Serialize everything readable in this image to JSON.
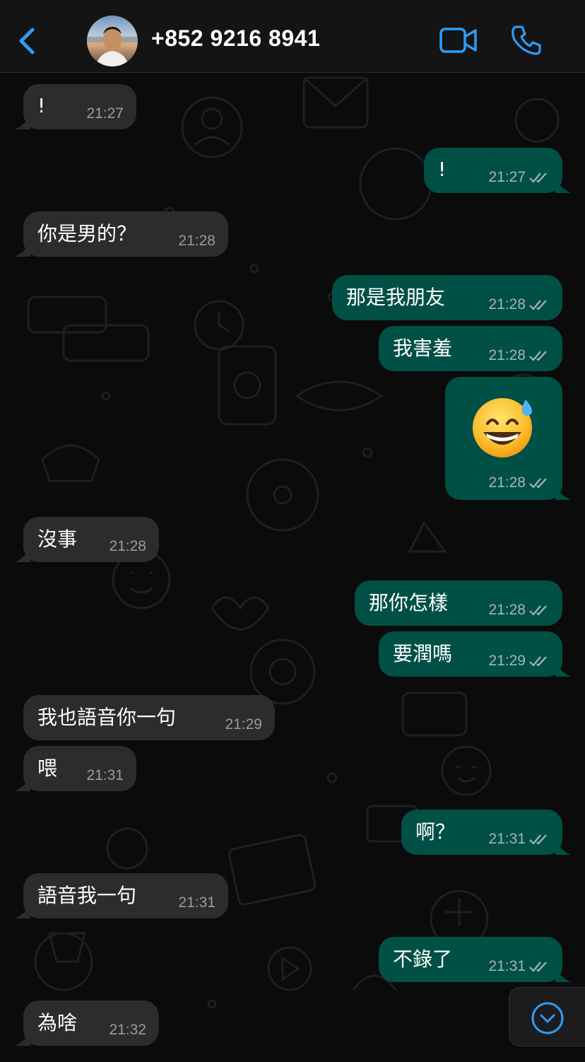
{
  "header": {
    "contact_name": "+852 9216 8941",
    "back_icon": "chevron-left-icon",
    "video_icon": "video-camera-icon",
    "call_icon": "phone-icon",
    "accent": "#2f9cf5"
  },
  "messages": [
    {
      "dir": "in",
      "text": "!",
      "time": "21:27"
    },
    {
      "dir": "out",
      "text": "!",
      "time": "21:27",
      "status": "read"
    },
    {
      "dir": "in",
      "text": "你是男的？",
      "time": "21:28"
    },
    {
      "dir": "out",
      "text": "那是我朋友",
      "time": "21:28",
      "status": "read"
    },
    {
      "dir": "out",
      "text": "我害羞",
      "time": "21:28",
      "status": "read"
    },
    {
      "dir": "out",
      "text": "😅",
      "time": "21:28",
      "status": "read",
      "kind": "emoji"
    },
    {
      "dir": "in",
      "text": "沒事",
      "time": "21:28"
    },
    {
      "dir": "out",
      "text": "那你怎樣",
      "time": "21:28",
      "status": "read"
    },
    {
      "dir": "out",
      "text": "要潤嗎",
      "time": "21:29",
      "status": "read"
    },
    {
      "dir": "in",
      "text": "我也語音你一句",
      "time": "21:29"
    },
    {
      "dir": "in",
      "text": "喂",
      "time": "21:31"
    },
    {
      "dir": "out",
      "text": "啊？",
      "time": "21:31",
      "status": "read"
    },
    {
      "dir": "in",
      "text": "語音我一句",
      "time": "21:31"
    },
    {
      "dir": "out",
      "text": "不錄了",
      "time": "21:31",
      "status": "read"
    },
    {
      "dir": "in",
      "text": "為啥",
      "time": "21:32"
    }
  ],
  "colors": {
    "incoming_bubble": "#2c2c2e",
    "outgoing_bubble": "#005046",
    "background": "#0b0b0b"
  },
  "scroll_button_icon": "chevron-down-circle-icon"
}
